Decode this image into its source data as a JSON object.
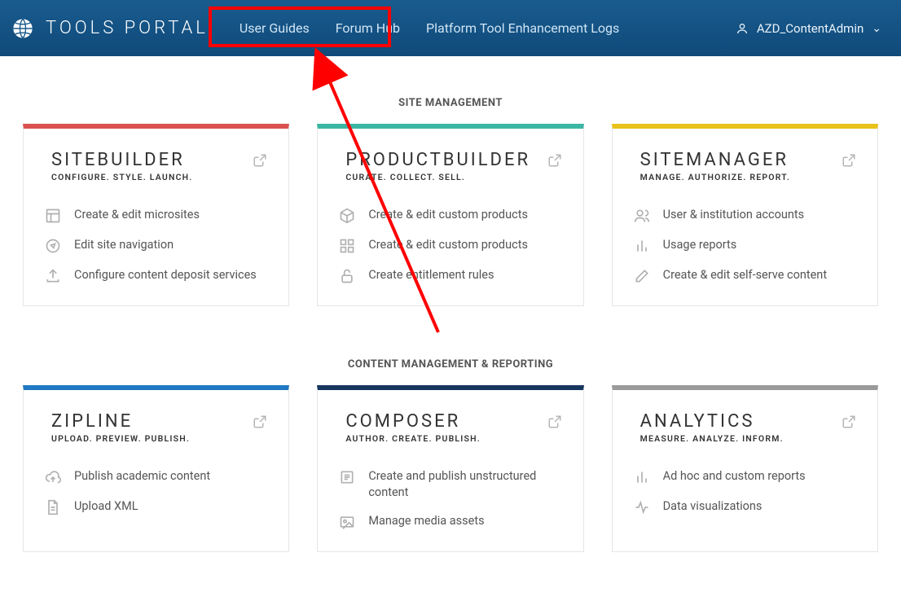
{
  "header": {
    "logo_text": "TOOLS PORTAL",
    "nav": {
      "guides": "User Guides",
      "forum": "Forum Hub",
      "logs": "Platform Tool Enhancement Logs"
    },
    "user": "AZD_ContentAdmin"
  },
  "sections": {
    "site_mgmt": {
      "title": "SITE MANAGEMENT",
      "cards": {
        "sitebuilder": {
          "title": "SITEBUILDER",
          "subtitle": "CONFIGURE. STYLE. LAUNCH.",
          "accent": "#d9534f",
          "items": [
            "Create & edit microsites",
            "Edit site navigation",
            "Configure content deposit services"
          ]
        },
        "productbuilder": {
          "title": "PRODUCTBUILDER",
          "subtitle": "CURATE. COLLECT. SELL.",
          "accent": "#3bb6a4",
          "items": [
            "Create & edit custom products",
            "Create & edit custom products",
            "Create entitlement rules"
          ]
        },
        "sitemanager": {
          "title": "SITEMANAGER",
          "subtitle": "MANAGE. AUTHORIZE. REPORT.",
          "accent": "#e9c21a",
          "items": [
            "User & institution accounts",
            "Usage reports",
            "Create & edit self-serve content"
          ]
        }
      }
    },
    "content_mgmt": {
      "title": "CONTENT MANAGEMENT & REPORTING",
      "cards": {
        "zipline": {
          "title": "ZIPLINE",
          "subtitle": "UPLOAD. PREVIEW. PUBLISH.",
          "accent": "#2079c3",
          "items": [
            "Publish academic content",
            "Upload XML"
          ]
        },
        "composer": {
          "title": "COMPOSER",
          "subtitle": "AUTHOR. CREATE. PUBLISH.",
          "accent": "#17365e",
          "items": [
            "Create and publish unstructured content",
            "Manage media assets"
          ]
        },
        "analytics": {
          "title": "ANALYTICS",
          "subtitle": "MEASURE. ANALYZE. INFORM.",
          "accent": "#9a9a9a",
          "items": [
            "Ad hoc and custom reports",
            "Data visualizations"
          ]
        }
      }
    }
  }
}
